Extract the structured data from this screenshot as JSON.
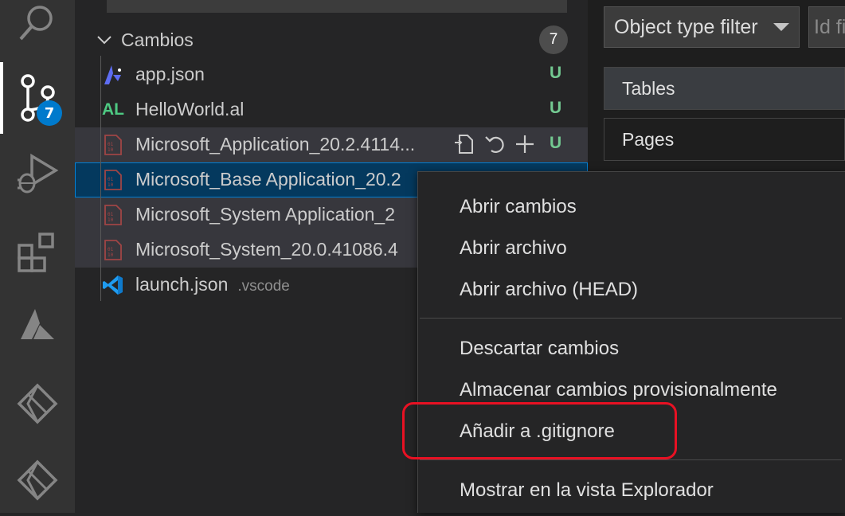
{
  "activity_bar": {
    "items": [
      "search-icon",
      "source-control-icon",
      "run-debug-icon",
      "extensions-icon",
      "azure-icon",
      "power-platform-icon",
      "power-platform-icon-2"
    ],
    "source_control_badge": "7"
  },
  "scm": {
    "section_title": "Cambios",
    "section_count": "7",
    "files": [
      {
        "name": "app.json",
        "desc": "",
        "status": "U",
        "icon": "al-app-icon"
      },
      {
        "name": "HelloWorld.al",
        "desc": "",
        "status": "U",
        "icon": "al-file-icon",
        "icon_text": "AL"
      },
      {
        "name": "Microsoft_Application_20.2.4114...",
        "desc": "",
        "status": "U",
        "icon": "binary-file-icon"
      },
      {
        "name": "Microsoft_Base Application_20.2",
        "desc": "",
        "status": "",
        "icon": "binary-file-icon"
      },
      {
        "name": "Microsoft_System Application_2",
        "desc": "",
        "status": "",
        "icon": "binary-file-icon"
      },
      {
        "name": "Microsoft_System_20.0.41086.4",
        "desc": "",
        "status": "",
        "icon": "binary-file-icon"
      },
      {
        "name": "launch.json",
        "desc": ".vscode",
        "status": "",
        "icon": "vscode-icon"
      }
    ]
  },
  "right_panel": {
    "filter_label": "Object type filter",
    "id_filter_placeholder": "Id fi",
    "buttons": [
      "Tables",
      "Pages"
    ]
  },
  "context_menu": {
    "items": [
      "Abrir cambios",
      "Abrir archivo",
      "Abrir archivo (HEAD)",
      "Descartar cambios",
      "Almacenar cambios provisionalmente",
      "Añadir a .gitignore",
      "Mostrar en la vista Explorador"
    ],
    "highlighted": "Añadir a .gitignore"
  },
  "colors": {
    "accent": "#007acc",
    "untracked": "#73c991",
    "highlight_box": "#e81123"
  }
}
